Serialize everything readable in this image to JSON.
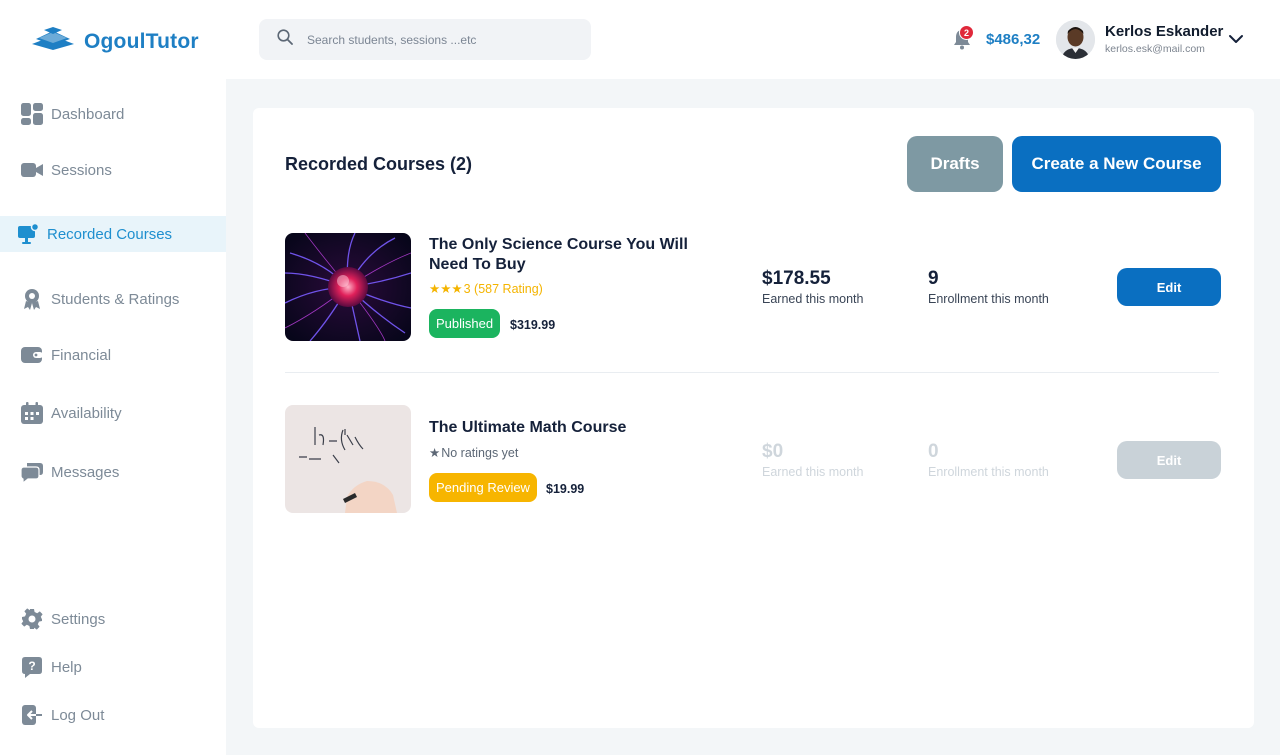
{
  "app": {
    "name": "OgoulTutor",
    "logo_icon": "graduation-book-icon"
  },
  "search": {
    "placeholder": "Search students, sessions ...etc"
  },
  "header": {
    "notification_count": "2",
    "balance": "$486,32",
    "user_name": "Kerlos Eskander",
    "user_email": "kerlos.esk@mail.com"
  },
  "sidebar": {
    "items": [
      {
        "label": "Dashboard",
        "icon": "dashboard-grid-icon",
        "active": false
      },
      {
        "label": "Sessions",
        "icon": "video-camera-icon",
        "active": false
      },
      {
        "label": "Recorded Courses",
        "icon": "monitor-play-icon",
        "active": true
      },
      {
        "label": "Students & Ratings",
        "icon": "student-badge-icon",
        "active": false
      },
      {
        "label": "Financial",
        "icon": "wallet-icon",
        "active": false
      },
      {
        "label": "Availability",
        "icon": "calendar-icon",
        "active": false
      },
      {
        "label": "Messages",
        "icon": "chat-bubbles-icon",
        "active": false
      }
    ],
    "bottom_items": [
      {
        "label": "Settings",
        "icon": "gear-icon"
      },
      {
        "label": "Help",
        "icon": "help-question-icon"
      },
      {
        "label": "Log Out",
        "icon": "logout-icon"
      }
    ]
  },
  "main": {
    "title": "Recorded Courses (2)",
    "drafts_label": "Drafts",
    "create_label": "Create a New Course",
    "courses": [
      {
        "title": "The Only Science Course You Will Need To Buy",
        "rating_stars": "★★★",
        "rating_text": "3 (587 Rating)",
        "status": "Published",
        "price": "$319.99",
        "earned": "$178.55",
        "earned_label": "Earned this month",
        "enrollment": "9",
        "enrollment_label": "Enrollment this month",
        "edit_label": "Edit",
        "thumbnail": "plasma-ball-image"
      },
      {
        "title": "The Ultimate Math Course",
        "rating_stars": "★",
        "rating_text": "No ratings yet",
        "status": "Pending Review",
        "price": "$19.99",
        "earned": "$0",
        "earned_label": "Earned this month",
        "enrollment": "0",
        "enrollment_label": "Enrollment this month",
        "edit_label": "Edit",
        "thumbnail": "whiteboard-math-image"
      }
    ]
  },
  "colors": {
    "brand": "#1e7fc4",
    "primary_button": "#0a6fc1",
    "drafts_button": "#7e99a3",
    "published": "#1bb45f",
    "pending": "#f7b500",
    "star": "#f4b400",
    "disabled_button": "#c9d2d8"
  }
}
